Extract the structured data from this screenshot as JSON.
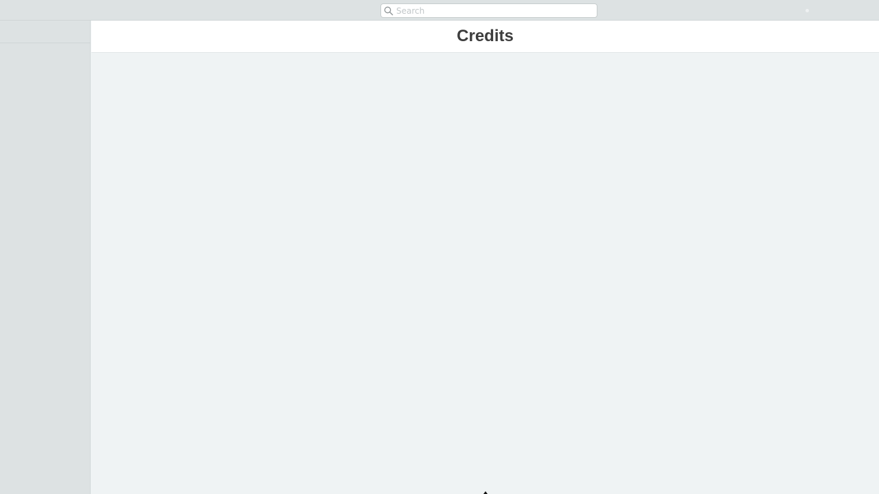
{
  "search": {
    "placeholder": "Search",
    "value": ""
  },
  "main": {
    "title": "Credits"
  },
  "icons": {
    "search": "search-icon",
    "cursor": "mouse-cursor-icon"
  },
  "colors": {
    "topbar_bg": "#dde2e3",
    "sidebar_bg": "#dde2e3",
    "content_bg": "#eff3f4",
    "title_bar_bg": "#ffffff",
    "title_text": "#3d3d3d"
  }
}
